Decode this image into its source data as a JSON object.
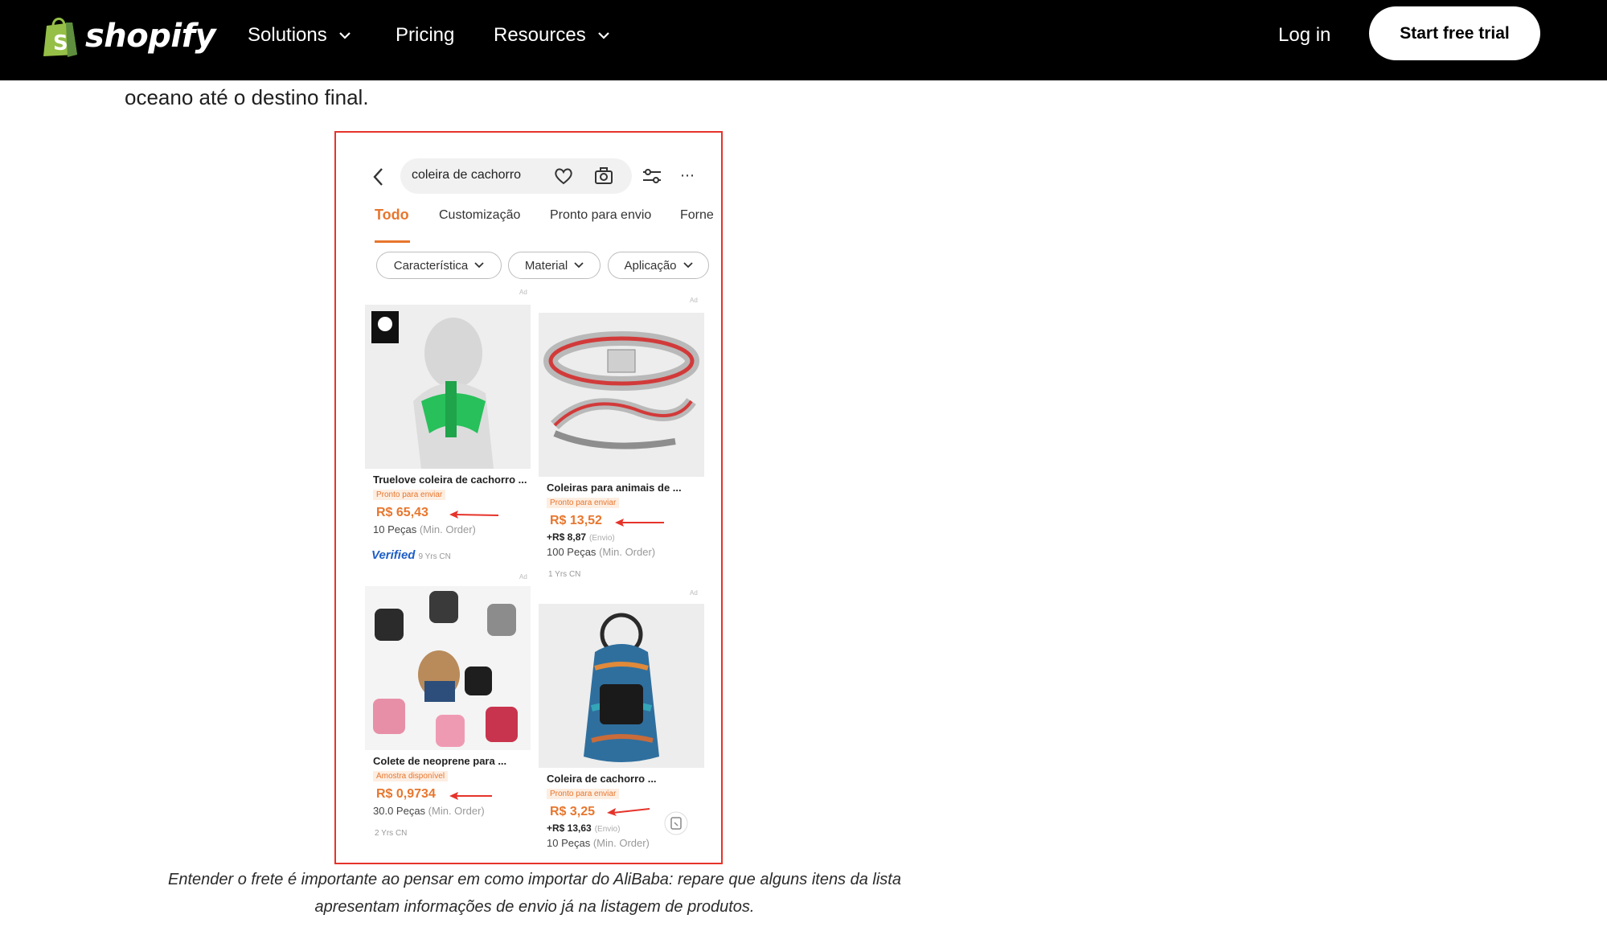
{
  "nav": {
    "brand": "shopify",
    "items": [
      {
        "label": "Solutions",
        "has_dropdown": true
      },
      {
        "label": "Pricing",
        "has_dropdown": false
      },
      {
        "label": "Resources",
        "has_dropdown": true
      }
    ],
    "login": "Log in",
    "cta": "Start free trial",
    "brand_color": "#95bf47"
  },
  "article": {
    "lead_text": "oceano até o destino final.",
    "caption_line1": "Entender o frete é importante ao pensar em como importar do AliBaba: repare que alguns itens da lista",
    "caption_line2": "apresentam informações de envio já na listagem de produtos."
  },
  "screenshot": {
    "search_query": "coleira de cachorro",
    "tabs": [
      "Todo",
      "Customização",
      "Pronto para envio",
      "Forne"
    ],
    "filters": [
      "Característica",
      "Material",
      "Aplicação"
    ],
    "products": [
      {
        "title": "Truelove coleira de cachorro ...",
        "tag": "Pronto para enviar",
        "price": "R$ 65,43",
        "moq": "10 Peças",
        "moq_note": "(Min. Order)",
        "verified": "Verified",
        "years": "9 Yrs CN"
      },
      {
        "title": "Coleiras para animais de ...",
        "tag": "Pronto para enviar",
        "price": "R$ 13,52",
        "shipping": "+R$ 8,87",
        "shipping_note": "(Envio)",
        "moq": "100 Peças",
        "moq_note": "(Min. Order)",
        "years": "1 Yrs CN"
      },
      {
        "title": "Colete de neoprene para ...",
        "tag": "Amostra disponível",
        "price": "R$ 0,9734",
        "moq": "30.0 Peças",
        "moq_note": "(Min. Order)",
        "years": "2 Yrs CN"
      },
      {
        "title": "Coleira de cachorro ...",
        "tag": "Pronto para enviar",
        "price": "R$ 3,25",
        "shipping": "+R$ 13,63",
        "shipping_note": "(Envio)",
        "moq": "10 Peças",
        "moq_note": "(Min. Order)"
      }
    ],
    "ad_label": "Ad",
    "accent_color": "#e8762d",
    "border_color": "#e6332a"
  }
}
